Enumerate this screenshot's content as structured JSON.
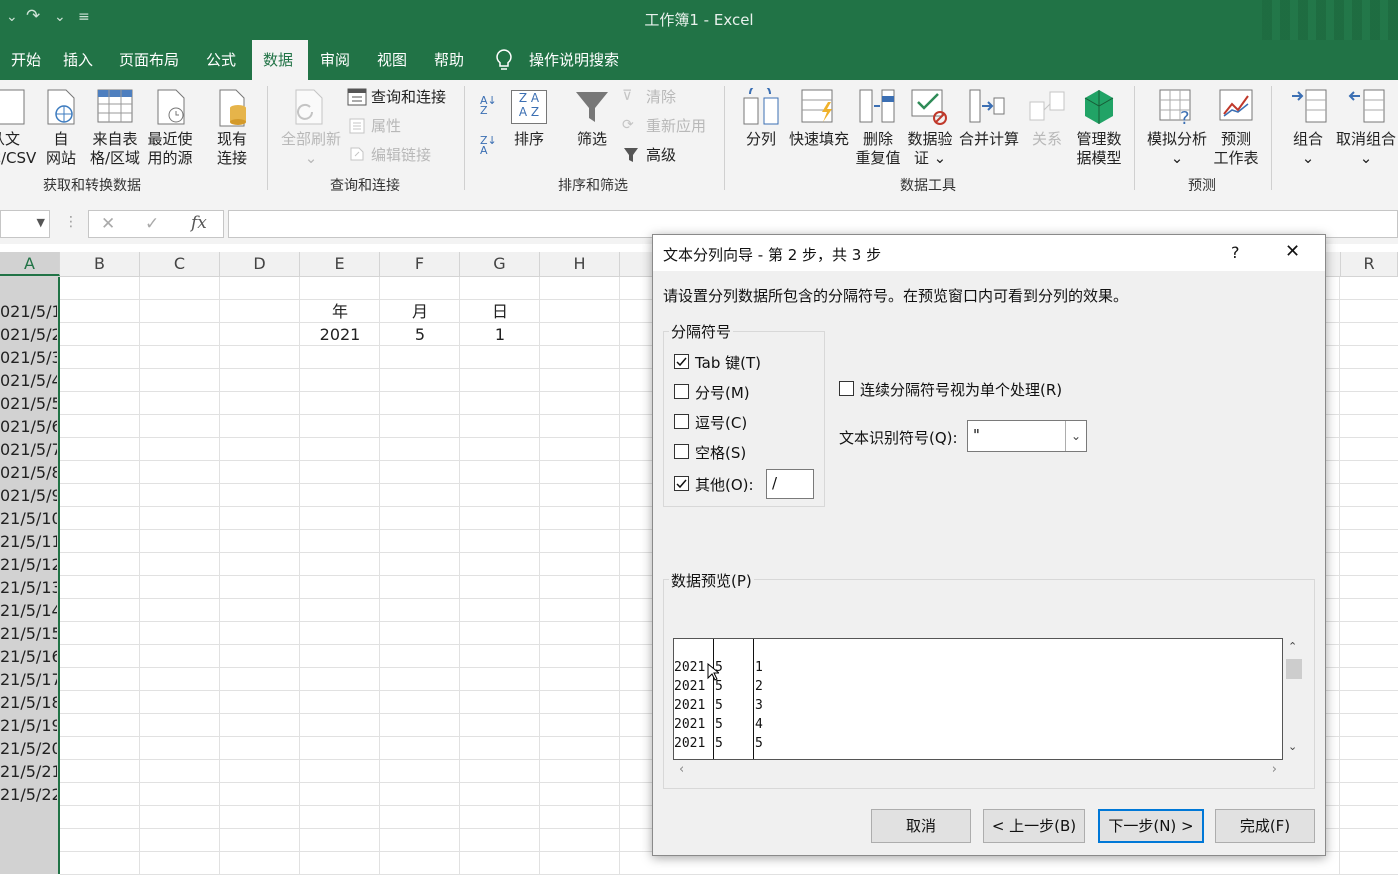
{
  "window": {
    "title": "工作簿1 - Excel"
  },
  "tabs": [
    "开始",
    "插入",
    "页面布局",
    "公式",
    "数据",
    "审阅",
    "视图",
    "帮助"
  ],
  "active_tab": "数据",
  "tell_me": "操作说明搜索",
  "ribbon": {
    "get_data": {
      "from_text_l1": "从文",
      "from_text_l2": "本/CSV",
      "from_web_l1": "自",
      "from_web_l2": "网站",
      "from_table_l1": "来自表",
      "from_table_l2": "格/区域",
      "recent_l1": "最近使",
      "recent_l2": "用的源",
      "existing_l1": "现有",
      "existing_l2": "连接",
      "group": "获取和转换数据"
    },
    "queries": {
      "refresh_all": "全部刷新",
      "queries_connections": "查询和连接",
      "properties": "属性",
      "edit_links": "编辑链接",
      "group": "查询和连接"
    },
    "sort_filter": {
      "sort": "排序",
      "filter": "筛选",
      "clear": "清除",
      "reapply": "重新应用",
      "advanced": "高级",
      "az": "A Z",
      "za": "Z A",
      "group": "排序和筛选"
    },
    "data_tools": {
      "text_to_columns": "分列",
      "flash_fill": "快速填充",
      "remove_dup_l1": "删除",
      "remove_dup_l2": "重复值",
      "validation_l1": "数据验",
      "validation_l2": "证",
      "consolidate": "合并计算",
      "relationships": "关系",
      "data_model_l1": "管理数",
      "data_model_l2": "据模型",
      "group": "数据工具"
    },
    "forecast": {
      "what_if": "模拟分析",
      "sheet_l1": "预测",
      "sheet_l2": "工作表",
      "group": "预测"
    },
    "outline": {
      "group_btn": "组合",
      "ungroup": "取消组合"
    }
  },
  "formula_bar": {
    "cancel": "✕",
    "enter": "✓",
    "fx": "fx"
  },
  "columns": [
    "A",
    "B",
    "C",
    "D",
    "E",
    "F",
    "G",
    "H",
    "R"
  ],
  "col_a_values": [
    "021/5/1",
    "021/5/2",
    "021/5/3",
    "021/5/4",
    "021/5/5",
    "021/5/6",
    "021/5/7",
    "021/5/8",
    "021/5/9",
    "21/5/10",
    "21/5/11",
    "21/5/12",
    "21/5/13",
    "21/5/14",
    "21/5/15",
    "21/5/16",
    "21/5/17",
    "21/5/18",
    "21/5/19",
    "21/5/20",
    "21/5/21",
    "21/5/22"
  ],
  "cells": {
    "E1": "年",
    "F1": "月",
    "G1": "日",
    "E2": "2021",
    "F2": "5",
    "G2": "1"
  },
  "dialog": {
    "title": "文本分列向导 - 第 2 步，共 3 步",
    "help": "?",
    "close": "✕",
    "instructions": "请设置分列数据所包含的分隔符号。在预览窗口内可看到分列的效果。",
    "delimiters_label": "分隔符号",
    "tab": {
      "label": "Tab 键(T)",
      "checked": true
    },
    "semicolon": {
      "label": "分号(M)",
      "checked": false
    },
    "comma": {
      "label": "逗号(C)",
      "checked": false
    },
    "space": {
      "label": "空格(S)",
      "checked": false
    },
    "other": {
      "label": "其他(O):",
      "checked": true,
      "value": "/"
    },
    "consecutive": {
      "label": "连续分隔符号视为单个处理(R)",
      "checked": false
    },
    "qualifier_label": "文本识别符号(Q):",
    "qualifier_value": "\"",
    "preview_label": "数据预览(P)",
    "preview_rows": [
      [
        "2021",
        "5",
        "1"
      ],
      [
        "2021",
        "5",
        "2"
      ],
      [
        "2021",
        "5",
        "3"
      ],
      [
        "2021",
        "5",
        "4"
      ],
      [
        "2021",
        "5",
        "5"
      ]
    ],
    "buttons": {
      "cancel": "取消",
      "back": "< 上一步(B)",
      "next": "下一步(N) >",
      "finish": "完成(F)"
    }
  }
}
